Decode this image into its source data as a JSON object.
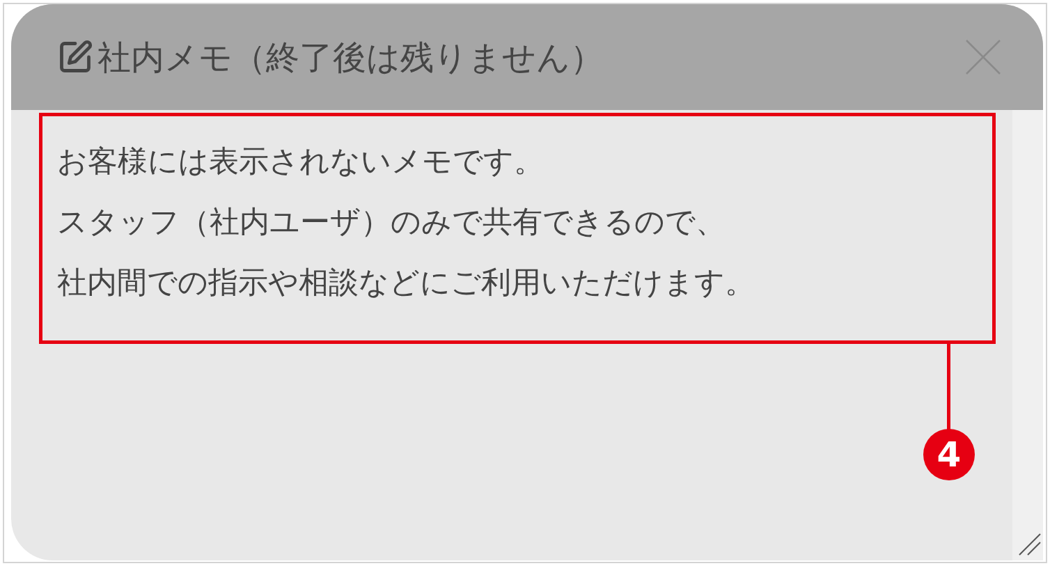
{
  "memo_panel": {
    "title": "社内メモ（終了後は残りません）",
    "lines": [
      "お客様には表示されないメモです。",
      "スタッフ（社内ユーザ）のみで共有できるので、",
      "社内間での指示や相談などにご利用いただけます。"
    ]
  },
  "annotation": {
    "number": "4"
  }
}
